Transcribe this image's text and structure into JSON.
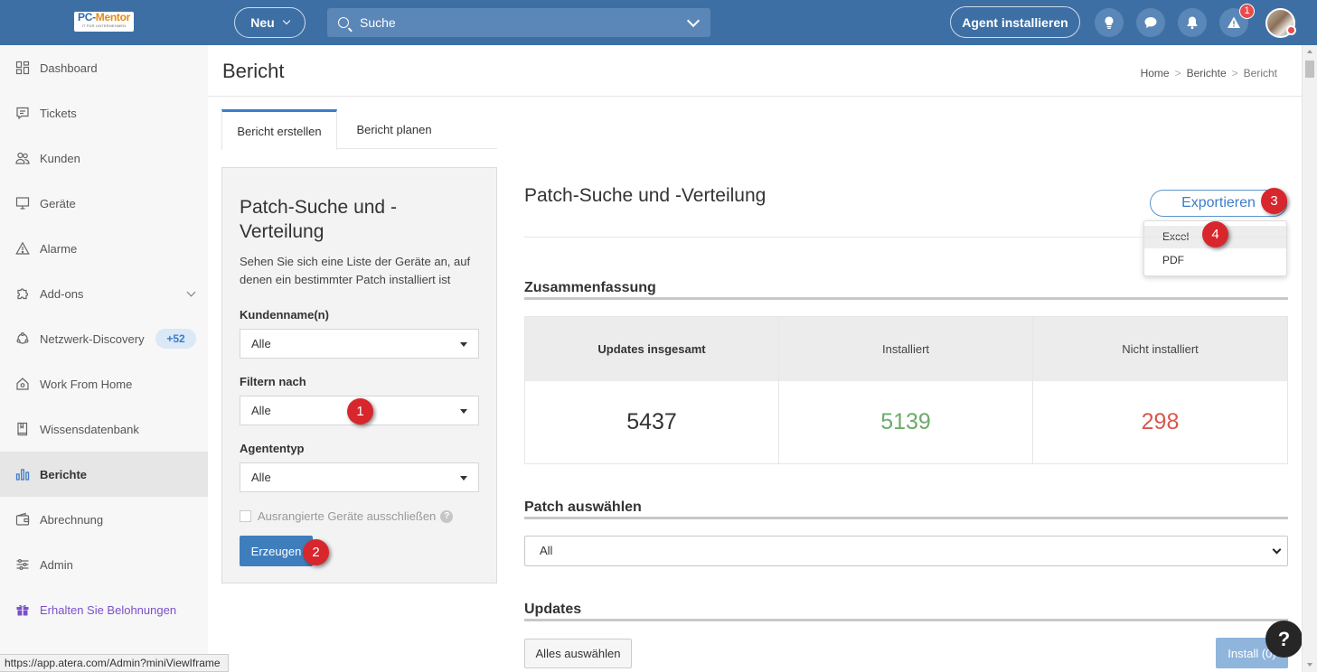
{
  "header": {
    "logo_main": "PC-",
    "logo_accent": "Mentor",
    "logo_sub": "IT FÜR UNTERNEHMEN",
    "new_label": "Neu",
    "search_placeholder": "Suche",
    "agent_label": "Agent installieren",
    "alert_count": "1",
    "icons": [
      "lightbulb-icon",
      "chat-icon",
      "bell-icon",
      "warning-icon"
    ]
  },
  "sidebar": {
    "items": [
      {
        "label": "Dashboard",
        "icon": "dashboard-icon"
      },
      {
        "label": "Tickets",
        "icon": "ticket-icon"
      },
      {
        "label": "Kunden",
        "icon": "customers-icon"
      },
      {
        "label": "Geräte",
        "icon": "monitor-icon"
      },
      {
        "label": "Alarme",
        "icon": "alert-icon"
      },
      {
        "label": "Add-ons",
        "icon": "puzzle-icon"
      },
      {
        "label": "Netzwerk-Discovery",
        "icon": "network-icon",
        "badge": "+52"
      },
      {
        "label": "Work From Home",
        "icon": "home-icon"
      },
      {
        "label": "Wissensdatenbank",
        "icon": "book-icon"
      },
      {
        "label": "Berichte",
        "icon": "bar-chart-icon",
        "active": true
      },
      {
        "label": "Abrechnung",
        "icon": "wallet-icon"
      },
      {
        "label": "Admin",
        "icon": "sliders-icon"
      },
      {
        "label": "Erhalten Sie Belohnungen",
        "icon": "gift-icon"
      }
    ]
  },
  "status_url": "https://app.atera.com/Admin?miniViewIframe",
  "page": {
    "title": "Bericht",
    "breadcrumb": [
      "Home",
      ">",
      "Berichte",
      ">",
      "Bericht"
    ]
  },
  "tabs": [
    "Bericht erstellen",
    "Bericht planen"
  ],
  "panel": {
    "title": "Patch-Suche und -Verteilung",
    "description": "Sehen Sie sich eine Liste der Geräte an, auf denen ein bestimmter Patch installiert ist",
    "fields": [
      {
        "label": "Kundenname(n)",
        "value": "Alle"
      },
      {
        "label": "Filtern nach",
        "value": "Alle"
      },
      {
        "label": "Agententyp",
        "value": "Alle"
      }
    ],
    "checkbox_label": "Ausrangierte Geräte ausschließen",
    "help": "?",
    "generate_label": "Erzeugen"
  },
  "markers": [
    "1",
    "2",
    "3",
    "4"
  ],
  "report": {
    "title": "Patch-Suche und -Verteilung",
    "export_label": "Exportieren",
    "export_options": [
      "Excel",
      "PDF"
    ],
    "summary_title": "Zusammenfassung",
    "summary": [
      {
        "label": "Updates insgesamt",
        "value": "5437",
        "color": "#333333"
      },
      {
        "label": "Installiert",
        "value": "5139",
        "color": "#6aac6a"
      },
      {
        "label": "Nicht installiert",
        "value": "298",
        "color": "#d9574f"
      }
    ],
    "patch_title": "Patch auswählen",
    "patch_value": "All",
    "updates_title": "Updates",
    "select_all_label": "Alles auswählen",
    "install_label": "Install (0)",
    "help_label": "?"
  },
  "colors": {
    "topbar": "#3d6fa5",
    "accent": "#3d7cc9",
    "marker": "#d8262d"
  }
}
